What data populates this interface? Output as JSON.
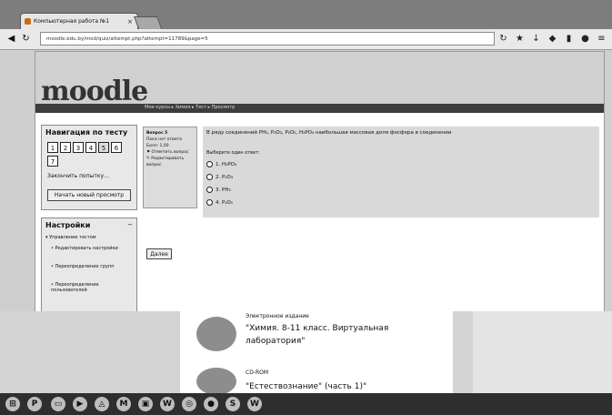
{
  "browser": {
    "tab_title": "Компьютерная работа №1",
    "tab_close": "×",
    "url": "moodle.edu.by/mod/quiz/attempt.php?attempt=11789&page=5",
    "back_icon": "arrow-left-icon",
    "reload_icon": "reload-icon"
  },
  "header": {
    "logo": "moodle",
    "breadcrumbs": "Мои курсы ▸ Химия ▸ Тест ▸ Просмотр"
  },
  "nav_block": {
    "title": "Навигация по тесту",
    "questions": [
      "1",
      "2",
      "3",
      "4",
      "5",
      "6",
      "7"
    ],
    "finish_link": "Закончить попытку...",
    "new_preview_button": "Начать новый просмотр"
  },
  "settings_block": {
    "title": "Настройки",
    "items": [
      "Управление тестом",
      "Редактировать настройки",
      "Переопределение групп",
      "Переопределение пользователей"
    ]
  },
  "question_info": {
    "number_label": "Вопрос 5",
    "status": "Пока нет ответа",
    "points": "Балл: 1,00",
    "flag": "Отметить вопрос",
    "edit": "Редактировать вопрос"
  },
  "question": {
    "text": "В ряду соединений PH₃, P₂O₃, P₂O₅, H₃PO₄ наибольшая массовая доля фосфора в соединении",
    "prompt": "Выберите один ответ:",
    "options": [
      "1. H₃PO₄",
      "2. P₂O₃",
      "3. PH₃",
      "4. P₂O₅"
    ]
  },
  "next_button": "Далее",
  "book": {
    "item1_type": "Электронное издание",
    "item1_title_line1": "\"Химия. 8-11 класс. Виртуальная",
    "item1_title_line2": "лаборатория\"",
    "item2_type": "CD-ROM",
    "item2_title": "\"Естествознание\" (часть 1)\""
  },
  "taskbar": {
    "icons": [
      "start-icon",
      "ps-icon",
      "explorer-icon",
      "media-icon",
      "app-icon",
      "mail-icon",
      "folder-icon",
      "word-icon",
      "chrome-icon",
      "record-icon",
      "skype-icon",
      "wps-icon"
    ],
    "glyphs": [
      "⊞",
      "P",
      "▭",
      "▶",
      "◬",
      "M",
      "▣",
      "W",
      "◎",
      "●",
      "S",
      "W"
    ]
  }
}
